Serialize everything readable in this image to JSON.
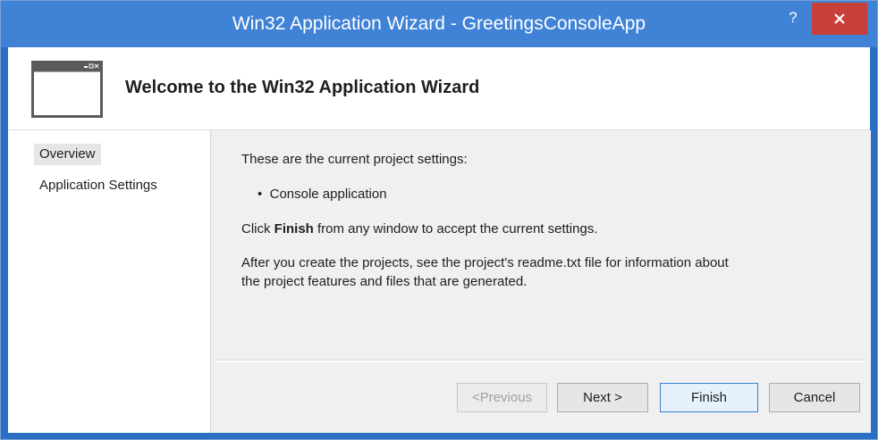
{
  "window": {
    "title": "Win32 Application Wizard - GreetingsConsoleApp",
    "help_label": "?",
    "close_icon": "close-x-icon"
  },
  "banner": {
    "title": "Welcome to the Win32 Application Wizard",
    "icon": "wizard-window-icon"
  },
  "nav": {
    "items": [
      {
        "label": "Overview",
        "selected": true
      },
      {
        "label": "Application Settings",
        "selected": false
      }
    ]
  },
  "main": {
    "intro": "These are the current project settings:",
    "bullets": [
      "Console application"
    ],
    "finish_prefix": "Click ",
    "finish_bold": "Finish",
    "finish_suffix": " from any window to accept the current settings.",
    "after_line1": "After you create the projects, see the project's readme.txt file for information about",
    "after_line2": "the project features and files that are generated."
  },
  "buttons": {
    "previous": "<Previous",
    "next": "Next >",
    "finish": "Finish",
    "cancel": "Cancel"
  },
  "colors": {
    "titlebar": "#3f82d6",
    "close_button": "#c7403a",
    "content_bg": "#f0f0f0"
  }
}
